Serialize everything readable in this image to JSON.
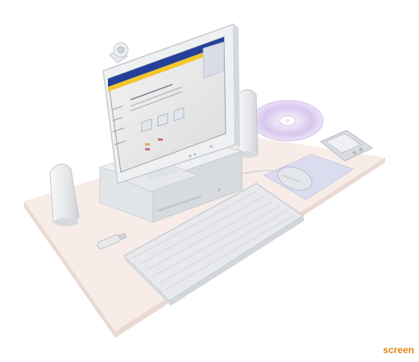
{
  "caption": {
    "text": "screen"
  },
  "colors": {
    "desk": "#f7ece7",
    "desk_edge": "#e9d9d2",
    "caption": "#e0861a",
    "monitor": "#eef0f2",
    "web_header": "#24409a",
    "web_band": "#f2c62c",
    "mousepad": "#dcdcf0",
    "cd": "#d8c8f0"
  },
  "objects": [
    {
      "name": "desk",
      "icon": "desk-surface"
    },
    {
      "name": "monitor",
      "icon": "flat-panel-monitor"
    },
    {
      "name": "webcam",
      "icon": "webcam"
    },
    {
      "name": "speaker-left",
      "icon": "speaker"
    },
    {
      "name": "speaker-right",
      "icon": "speaker"
    },
    {
      "name": "computer-base",
      "icon": "desktop-tower"
    },
    {
      "name": "keyboard",
      "icon": "keyboard"
    },
    {
      "name": "mouse",
      "icon": "mouse"
    },
    {
      "name": "mousepad",
      "icon": "mousepad"
    },
    {
      "name": "cd-disc",
      "icon": "compact-disc"
    },
    {
      "name": "pda",
      "icon": "handheld-pda"
    },
    {
      "name": "usb-drive",
      "icon": "usb-stick"
    }
  ]
}
